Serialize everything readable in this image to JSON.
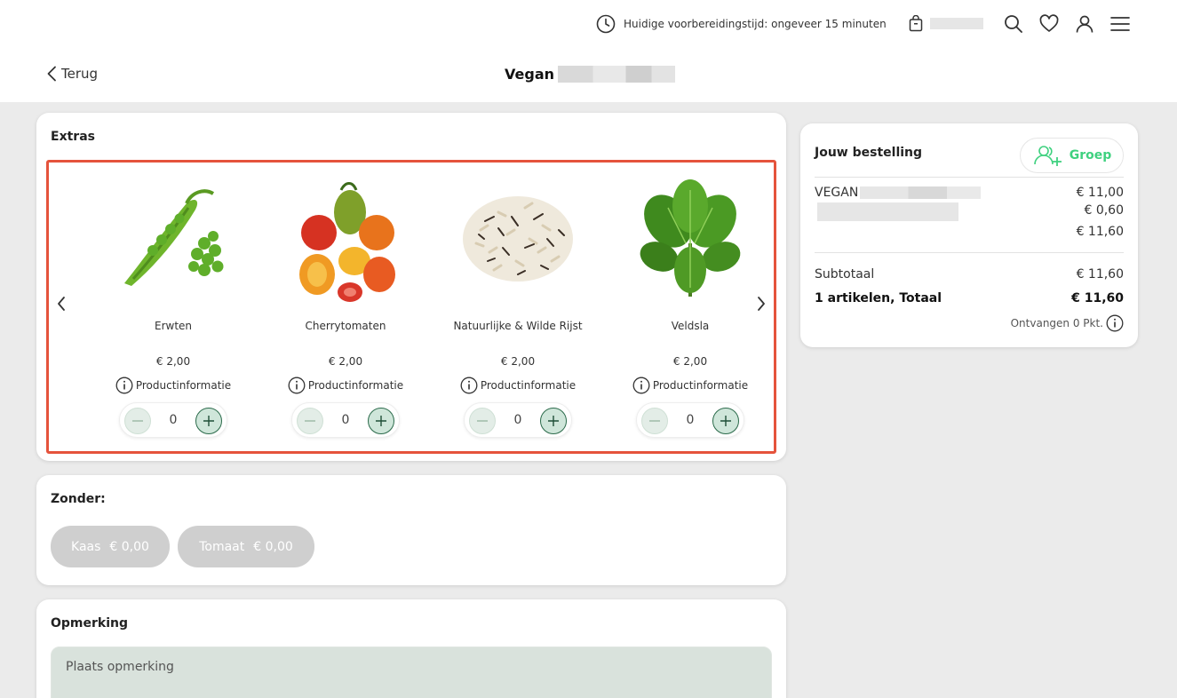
{
  "header": {
    "prep_time_text": "Huidige voorbereidingstijd: ongeveer 15 minuten",
    "back_label": "Terug",
    "title": "Vegan"
  },
  "extras": {
    "title": "Extras",
    "products": [
      {
        "name": "Erwten",
        "price": "€ 2,00",
        "info_label": "Productinformatie",
        "quantity": "0"
      },
      {
        "name": "Cherrytomaten",
        "price": "€ 2,00",
        "info_label": "Productinformatie",
        "quantity": "0"
      },
      {
        "name": "Natuurlijke & Wilde Rijst",
        "price": "€ 2,00",
        "info_label": "Productinformatie",
        "quantity": "0"
      },
      {
        "name": "Veldsla",
        "price": "€ 2,00",
        "info_label": "Productinformatie",
        "quantity": "0"
      }
    ]
  },
  "without": {
    "title": "Zonder:",
    "options": [
      {
        "label": "Kaas",
        "price": "€ 0,00"
      },
      {
        "label": "Tomaat",
        "price": "€ 0,00"
      }
    ]
  },
  "remark": {
    "title": "Opmerking",
    "placeholder": "Plaats opmerking"
  },
  "order": {
    "title": "Jouw bestelling",
    "group_label": "Groep",
    "item_name": "VEGAN",
    "item_price": "€ 11,00",
    "extra_price": "€ 0,60",
    "item_total": "€ 11,60",
    "subtotal_label": "Subtotaal",
    "subtotal_value": "€ 11,60",
    "total_label": "1 artikelen, Totaal",
    "total_value": "€ 11,60",
    "points_text": "Ontvangen 0 Pkt."
  },
  "colors": {
    "accent_green": "#3fd17f",
    "highlight_border": "#e5533c",
    "stepper_plus_border": "#2a6a4a"
  }
}
